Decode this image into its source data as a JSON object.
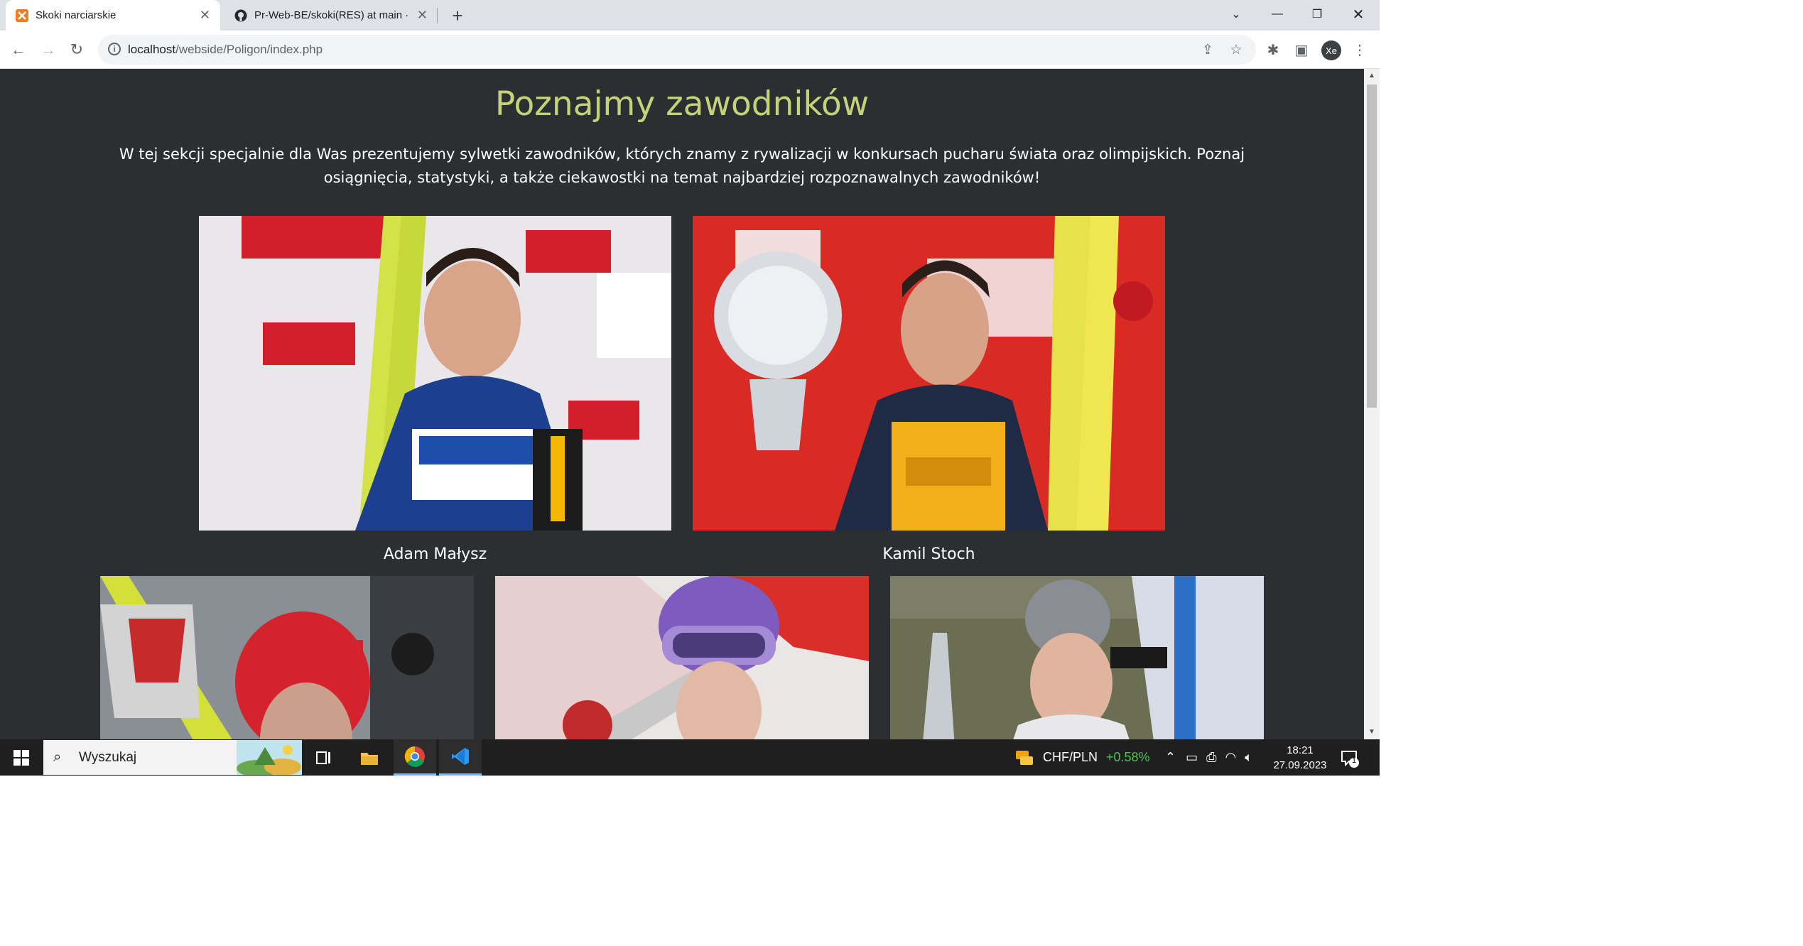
{
  "browser": {
    "tabs": [
      {
        "title": "Skoki narciarskie",
        "active": true
      },
      {
        "title": "Pr-Web-BE/skoki(RES) at main ·",
        "active": false
      }
    ],
    "url_host": "localhost",
    "url_path": "/webside/Poligon/index.php",
    "profile_initials": "Xe"
  },
  "page": {
    "heading": "Poznajmy zawodników",
    "intro": "W tej sekcji specjalnie dla Was prezentujemy sylwetki zawodników, których znamy z rywalizacji w konkursach pucharu świata oraz olimpijskich. Poznaj osiągnięcia, statystyki, a także ciekawostki na temat najbardziej rozpoznawalnych zawodników!",
    "athletes": [
      {
        "name": "Adam Małysz"
      },
      {
        "name": "Kamil Stoch"
      },
      {
        "name": ""
      },
      {
        "name": ""
      },
      {
        "name": ""
      }
    ],
    "heading_color": "#c5d27a",
    "background_color": "#2b2f31"
  },
  "taskbar": {
    "search_placeholder": "Wyszukaj",
    "ticker_symbol": "CHF/PLN",
    "ticker_change": "+0.58%",
    "time": "18:21",
    "date": "27.09.2023",
    "notification_count": "1"
  }
}
